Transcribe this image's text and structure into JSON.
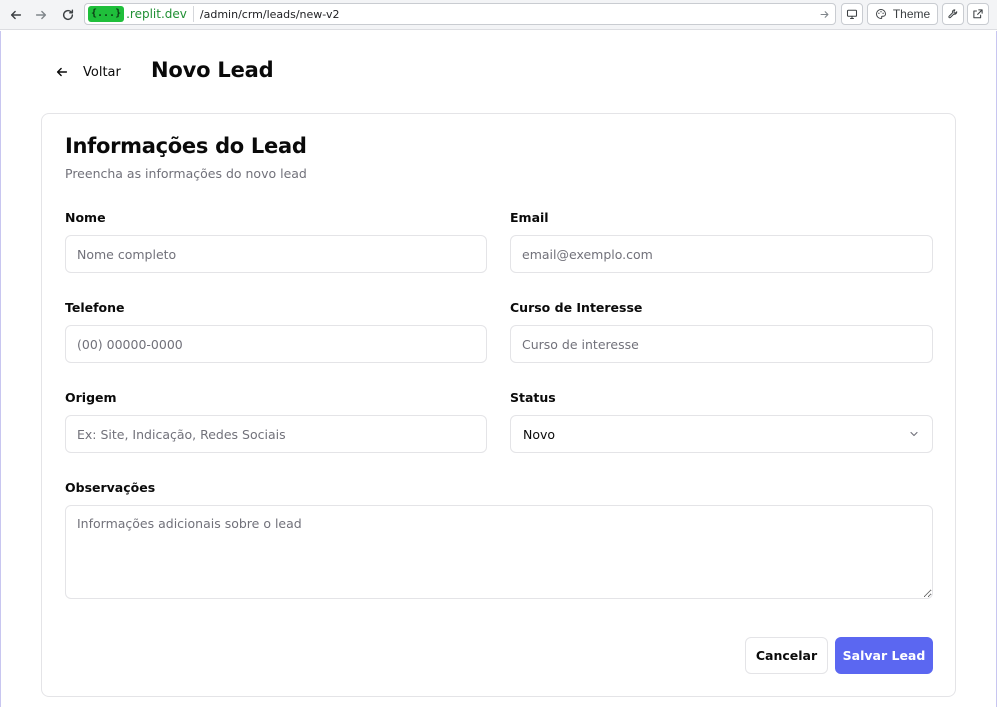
{
  "browser": {
    "url_badge": "{...}",
    "url_host": ".replit.dev",
    "url_path": "/admin/crm/leads/new-v2",
    "theme_label": "Theme",
    "icons": [
      "arrow-left-icon",
      "arrow-right-icon",
      "reload-icon",
      "monitor-icon",
      "palette-icon",
      "wrench-icon",
      "external-link-icon"
    ]
  },
  "header": {
    "back_label": "Voltar",
    "title": "Novo Lead"
  },
  "card": {
    "title": "Informações do Lead",
    "subtitle": "Preencha as informações do novo lead"
  },
  "form": {
    "nome": {
      "label": "Nome",
      "placeholder": "Nome completo",
      "value": ""
    },
    "email": {
      "label": "Email",
      "placeholder": "email@exemplo.com",
      "value": ""
    },
    "telefone": {
      "label": "Telefone",
      "placeholder": "(00) 00000-0000",
      "value": ""
    },
    "curso": {
      "label": "Curso de Interesse",
      "placeholder": "Curso de interesse",
      "value": ""
    },
    "origem": {
      "label": "Origem",
      "placeholder": "Ex: Site, Indicação, Redes Sociais",
      "value": ""
    },
    "status": {
      "label": "Status",
      "selected": "Novo"
    },
    "observacoes": {
      "label": "Observações",
      "placeholder": "Informações adicionais sobre o lead",
      "value": ""
    }
  },
  "actions": {
    "cancel_label": "Cancelar",
    "save_label": "Salvar Lead"
  },
  "colors": {
    "primary": "#5b67f1",
    "border": "#e4e4e7",
    "muted_text": "#71717a",
    "url_badge_bg": "#1fbf3b"
  }
}
